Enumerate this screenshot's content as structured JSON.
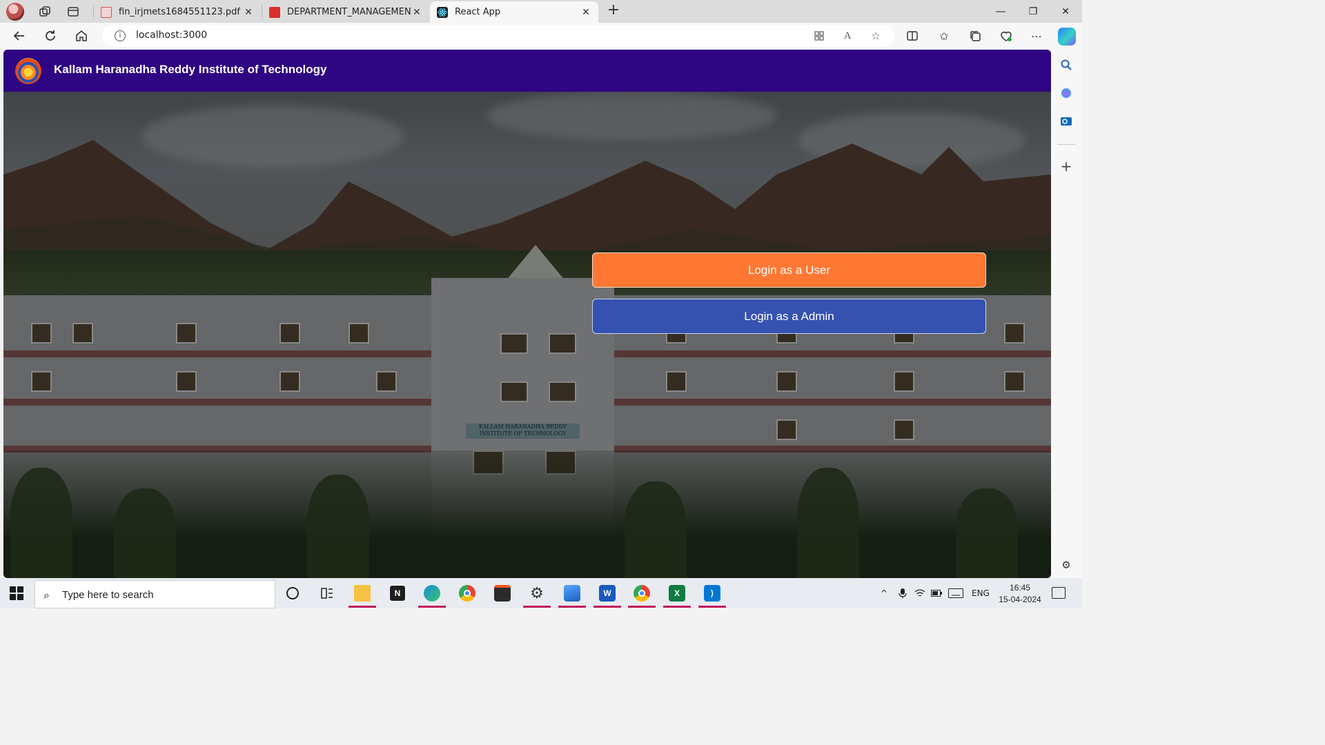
{
  "browser": {
    "tabs": [
      {
        "label": "fin_irjmets1684551123.pdf",
        "icon": "pdf-icon",
        "active": false
      },
      {
        "label": "DEPARTMENT_MANAGEMENT_S",
        "icon": "pdf-icon",
        "active": false
      },
      {
        "label": "React App",
        "icon": "react-icon",
        "active": true
      }
    ],
    "url": "localhost:3000"
  },
  "app": {
    "title": "Kallam Haranadha Reddy Institute of Technology",
    "logo": "college-logo",
    "hero_sign": "KALLAM HARANADHA REDDY INSTITUTE OF TECHNOLOGY",
    "buttons": {
      "user_login": "Login as a User",
      "admin_login": "Login as a Admin"
    },
    "colors": {
      "header_bg": "#2e0582",
      "user_button": "#fe7833",
      "admin_button": "#3552b0"
    }
  },
  "taskbar": {
    "search_placeholder": "Type here to search",
    "language": "ENG",
    "time": "16:45",
    "date": "15-04-2024",
    "apps": [
      "task-view",
      "file-explorer",
      "notion",
      "edge",
      "chrome",
      "store",
      "settings",
      "photos",
      "word",
      "chrome-profile",
      "excel",
      "vscode"
    ]
  }
}
